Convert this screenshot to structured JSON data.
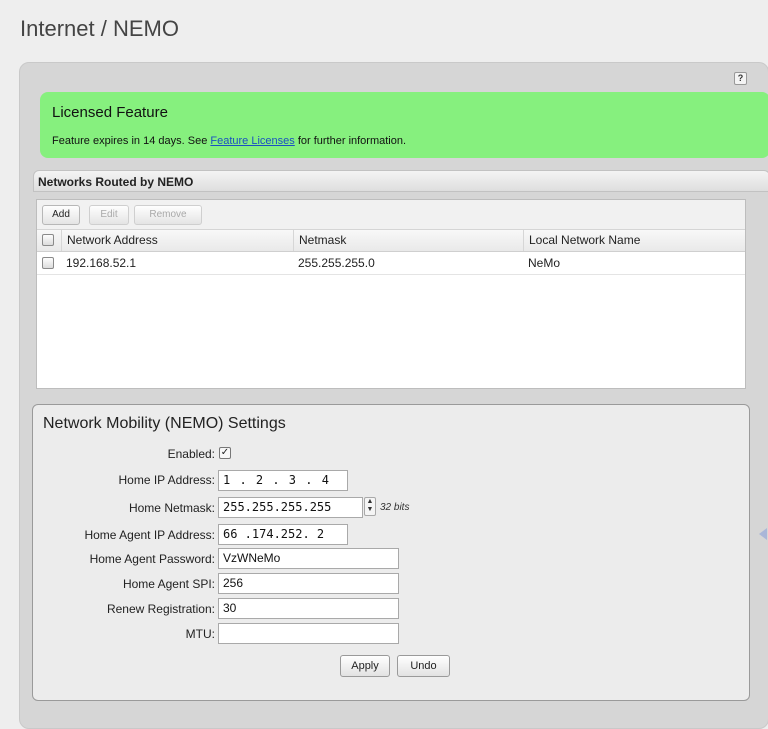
{
  "page": {
    "title": "Internet / NEMO",
    "help_label": "?"
  },
  "license": {
    "title": "Licensed Feature",
    "text_before": "Feature expires in 14 days. See ",
    "link_text": "Feature Licenses",
    "text_after": " for further information.",
    "banner_color": "#86f07e"
  },
  "networks": {
    "header": "Networks Routed by NEMO",
    "toolbar": {
      "add": "Add",
      "edit": "Edit",
      "remove": "Remove"
    },
    "columns": [
      "Network Address",
      "Netmask",
      "Local Network Name"
    ],
    "rows": [
      {
        "address": "192.168.52.1",
        "netmask": "255.255.255.0",
        "name": "NeMo"
      }
    ]
  },
  "settings": {
    "title": "Network Mobility (NEMO) Settings",
    "enabled_label": "Enabled:",
    "enabled": true,
    "home_ip_label": "Home IP Address:",
    "home_ip": "1 . 2 . 3 . 4",
    "home_netmask_label": "Home Netmask:",
    "home_netmask": "255.255.255.255",
    "netmask_bits": "32 bits",
    "home_agent_ip_label": "Home Agent IP Address:",
    "home_agent_ip": "66 .174.252. 2",
    "home_agent_password_label": "Home Agent Password:",
    "home_agent_password": "VzWNeMo",
    "home_agent_spi_label": "Home Agent SPI:",
    "home_agent_spi": "256",
    "renew_label": "Renew Registration:",
    "renew": "30",
    "mtu_label": "MTU:",
    "mtu": "",
    "apply_label": "Apply",
    "undo_label": "Undo"
  }
}
